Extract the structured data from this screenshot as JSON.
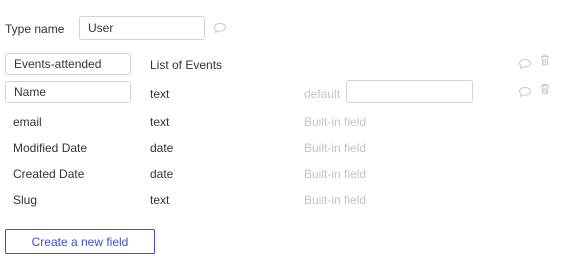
{
  "type_name": {
    "label": "Type name",
    "value": "User"
  },
  "fields": [
    {
      "name": "Events-attended",
      "type": "List of Events",
      "editable": true
    },
    {
      "name": "Name",
      "type": "text",
      "editable": true,
      "default_label": "default",
      "default_value": ""
    },
    {
      "name": "email",
      "type": "text",
      "note": "Built-in field"
    },
    {
      "name": "Modified Date",
      "type": "date",
      "note": "Built-in field"
    },
    {
      "name": "Created Date",
      "type": "date",
      "note": "Built-in field"
    },
    {
      "name": "Slug",
      "type": "text",
      "note": "Built-in field"
    }
  ],
  "actions": {
    "create_field_label": "Create a new field"
  },
  "colors": {
    "accent": "#3f50c8",
    "muted_text": "#c3c3c3",
    "border": "#d2d2d2"
  }
}
